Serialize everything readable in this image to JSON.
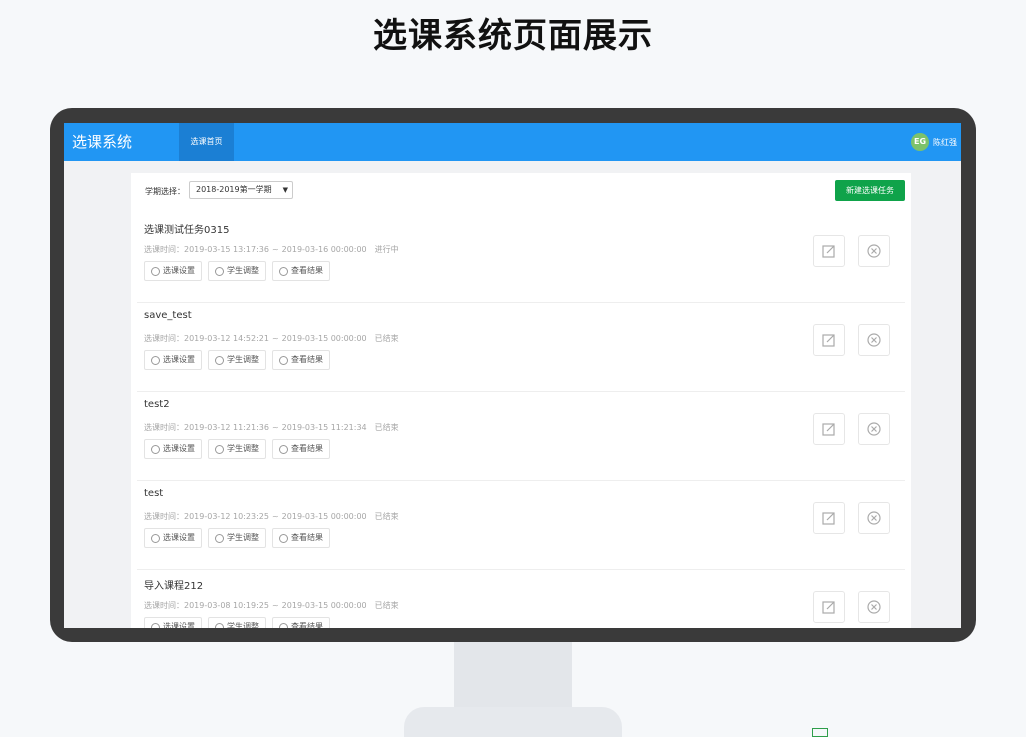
{
  "heading": "选课系统页面展示",
  "app": {
    "title": "选课系统",
    "nav_tab": "选课首页",
    "user": {
      "avatar_text": "EG",
      "name": "陈红强"
    }
  },
  "toolbar": {
    "term_label": "学期选择：",
    "term_value": "2018-2019第一学期",
    "new_task_label": "新建选课任务"
  },
  "task_actions": {
    "settings": "选课设置",
    "adjust": "学生调整",
    "results": "查看结果"
  },
  "tasks": [
    {
      "name": "选课测试任务0315",
      "time_label": "选课时间：",
      "start": "2019-03-15 13:17:36",
      "end": "2019-03-16 00:00:00",
      "status": "进行中"
    },
    {
      "name": "save_test",
      "time_label": "选课时间：",
      "start": "2019-03-12 14:52:21",
      "end": "2019-03-15 00:00:00",
      "status": "已结束"
    },
    {
      "name": "test2",
      "time_label": "选课时间：",
      "start": "2019-03-12 11:21:36",
      "end": "2019-03-15 11:21:34",
      "status": "已结束"
    },
    {
      "name": "test",
      "time_label": "选课时间：",
      "start": "2019-03-12 10:23:25",
      "end": "2019-03-15 00:00:00",
      "status": "已结束"
    },
    {
      "name": "导入课程212",
      "time_label": "选课时间：",
      "start": "2019-03-08 10:19:25",
      "end": "2019-03-15 00:00:00",
      "status": "已结束"
    }
  ],
  "separator": "~",
  "colors": {
    "header_blue": "#2196f3",
    "nav_active": "#1b7fd4",
    "new_button_green": "#0fa34a"
  }
}
